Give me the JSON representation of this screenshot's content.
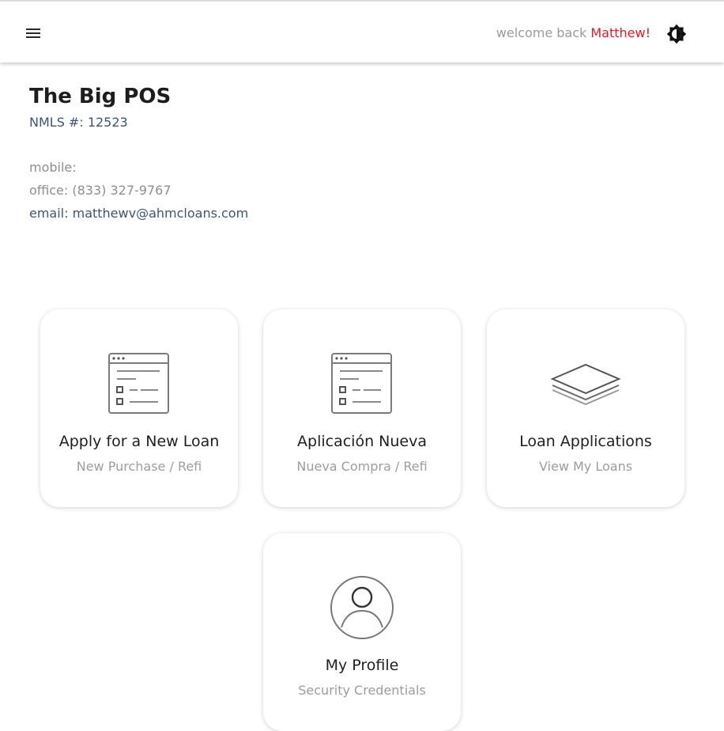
{
  "header": {
    "menu_icon": "menu-icon",
    "welcome_prefix": "welcome back ",
    "user_name": "Matthew!",
    "theme_icon": "brightness-icon"
  },
  "company": {
    "name": "The Big POS",
    "nmls": "NMLS #: 12523"
  },
  "contact": {
    "mobile": "mobile:",
    "office": "office: (833) 327-9767",
    "email": "email: matthewv@ahmcloans.com"
  },
  "cards": [
    {
      "title": "Apply for a New Loan",
      "subtitle": "New Purchase / Refi",
      "icon": "application-form-icon"
    },
    {
      "title": "Aplicación Nueva",
      "subtitle": "Nueva Compra / Refi",
      "icon": "application-form-icon"
    },
    {
      "title": "Loan Applications",
      "subtitle": "View My Loans",
      "icon": "layers-icon"
    },
    {
      "title": "My Profile",
      "subtitle": "Security Credentials",
      "icon": "user-profile-icon"
    }
  ],
  "colors": {
    "accent_red": "#e5192a",
    "link_blue": "#3f5474",
    "muted_gray": "#9a9a9a"
  }
}
